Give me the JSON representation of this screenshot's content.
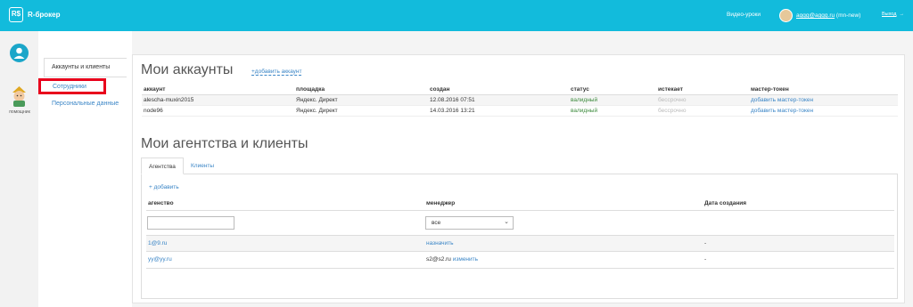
{
  "topbar": {
    "logo_text": "R$",
    "brand": "R-брокер",
    "video_link": "Видео-уроки",
    "user_login": "aggg@aggg.ru",
    "user_suffix": "(mn-new)",
    "logout": "Выход",
    "colors": {
      "bar": "#12bbdc"
    }
  },
  "leftrail": {
    "profile_icon": "user-circle-icon",
    "helper_label": "помощник"
  },
  "sidenav": {
    "items": [
      {
        "label": "Аккаунты и клиенты"
      },
      {
        "label": "Сотрудники"
      },
      {
        "label": "Персональные данные"
      }
    ]
  },
  "accounts": {
    "title": "Мои аккаунты",
    "add_link": "+добавить аккаунт",
    "columns": [
      "аккаунт",
      "площадка",
      "создан",
      "статус",
      "истекает",
      "мастер-токен"
    ],
    "rows": [
      {
        "account": "alescha-muxin2015",
        "platform": "Яндекс. Директ",
        "created": "12.08.2016 07:51",
        "status": "валидный",
        "expires": "бессрочно",
        "token": "добавить мастер-токен"
      },
      {
        "account": "node96",
        "platform": "Яндекс. Директ",
        "created": "14.03.2016 13:21",
        "status": "валидный",
        "expires": "бессрочно",
        "token": "добавить мастер-токен"
      }
    ]
  },
  "agencies": {
    "title": "Мои агентства и клиенты",
    "tabs": [
      "Агентства",
      "Клиенты"
    ],
    "add_link": "+ добавить",
    "columns": [
      "агенство",
      "менеджер",
      "Дата создания"
    ],
    "filter": {
      "input_value": "",
      "select_value": "все"
    },
    "rows": [
      {
        "agency": "1@9.ru",
        "manager": "",
        "manager_link": "назначить",
        "date": "-"
      },
      {
        "agency": "yy@yy.ru",
        "manager": "s2@s2.ru",
        "manager_link": "изменить",
        "date": "-"
      }
    ]
  }
}
